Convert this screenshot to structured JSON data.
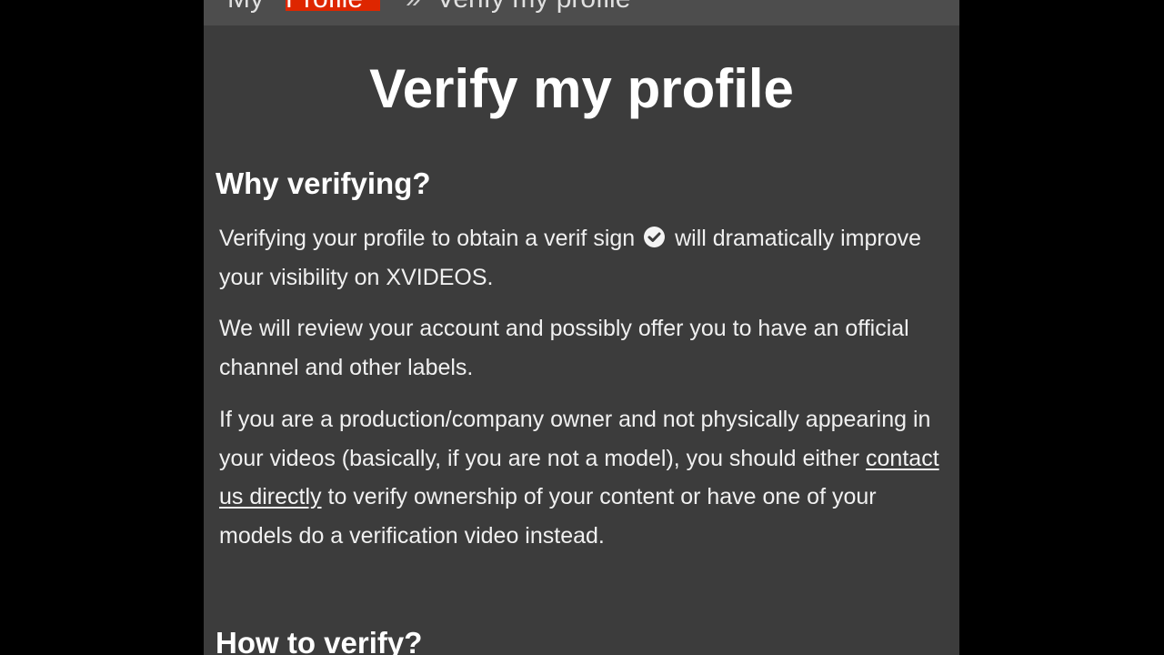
{
  "breadcrumb": {
    "first": "My",
    "highlight": "Profile",
    "separator": "»",
    "current": "Verify my profile"
  },
  "page": {
    "title": "Verify my profile"
  },
  "why_section": {
    "heading": "Why verifying?",
    "p1_before_icon": "Verifying your profile to obtain a verif sign",
    "p1_after_icon": "will dramatically improve your visibility on XVIDEOS.",
    "p2": "We will review your account and possibly offer you to have an official channel and other labels.",
    "p3_before_link": "If you are a production/company owner and not physically appearing in your videos (basically, if you are not a model), you should either",
    "p3_link": "contact us directly",
    "p3_after_link": "to verify ownership of your content or have one of your models do a verification video instead."
  },
  "how_section": {
    "heading": "How to verify?"
  },
  "icons": {
    "verified": "check-circle-icon"
  },
  "colors": {
    "background": "#3c3c3c",
    "highlight": "#de2600",
    "text": "#f0f0f0"
  }
}
